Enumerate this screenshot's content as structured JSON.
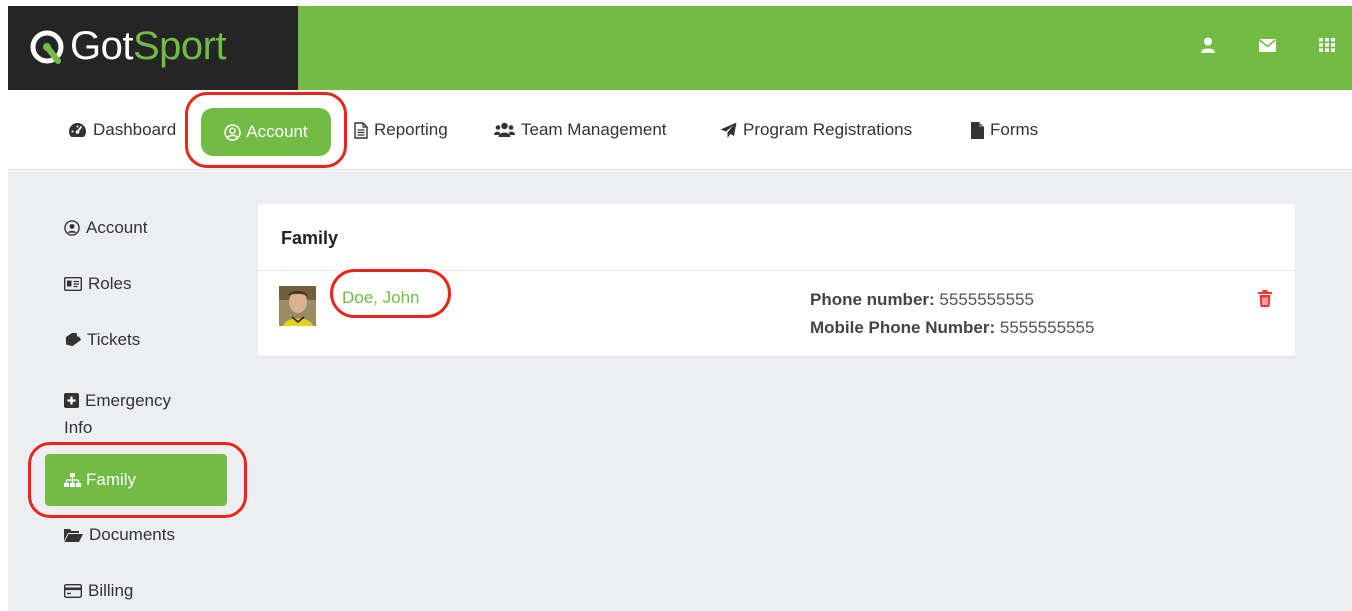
{
  "brand": {
    "got": "Got",
    "sport": "Sport",
    "accent": "#72bb45",
    "dark": "#252525"
  },
  "topbar": {
    "icons": [
      "user-icon",
      "envelope-icon",
      "apps-grid-icon"
    ]
  },
  "nav": {
    "items": [
      {
        "label": "Dashboard",
        "icon": "tachometer-icon"
      },
      {
        "label": "Account",
        "icon": "user-circle-icon",
        "active": true
      },
      {
        "label": "Reporting",
        "icon": "file-text-icon"
      },
      {
        "label": "Team Management",
        "icon": "users-icon"
      },
      {
        "label": "Program Registrations",
        "icon": "paper-plane-icon"
      },
      {
        "label": "Forms",
        "icon": "file-icon"
      }
    ]
  },
  "sidebar": {
    "items": [
      {
        "label": "Account",
        "icon": "user-circle-icon"
      },
      {
        "label": "Roles",
        "icon": "id-card-icon"
      },
      {
        "label": "Tickets",
        "icon": "ticket-icon"
      },
      {
        "label": "Emergency",
        "label2": "Info",
        "icon": "plus-square-icon"
      },
      {
        "label": "Family",
        "icon": "sitemap-icon",
        "active": true
      },
      {
        "label": "Documents",
        "icon": "folder-open-icon"
      },
      {
        "label": "Billing",
        "icon": "credit-card-icon"
      }
    ]
  },
  "family": {
    "title": "Family",
    "member": {
      "name": "Doe, John",
      "phone_label": "Phone number:",
      "phone": "5555555555",
      "mobile_label": "Mobile Phone Number:",
      "mobile": "5555555555"
    }
  },
  "colors": {
    "annotation": "#e8261c",
    "delete": "#e53935"
  }
}
